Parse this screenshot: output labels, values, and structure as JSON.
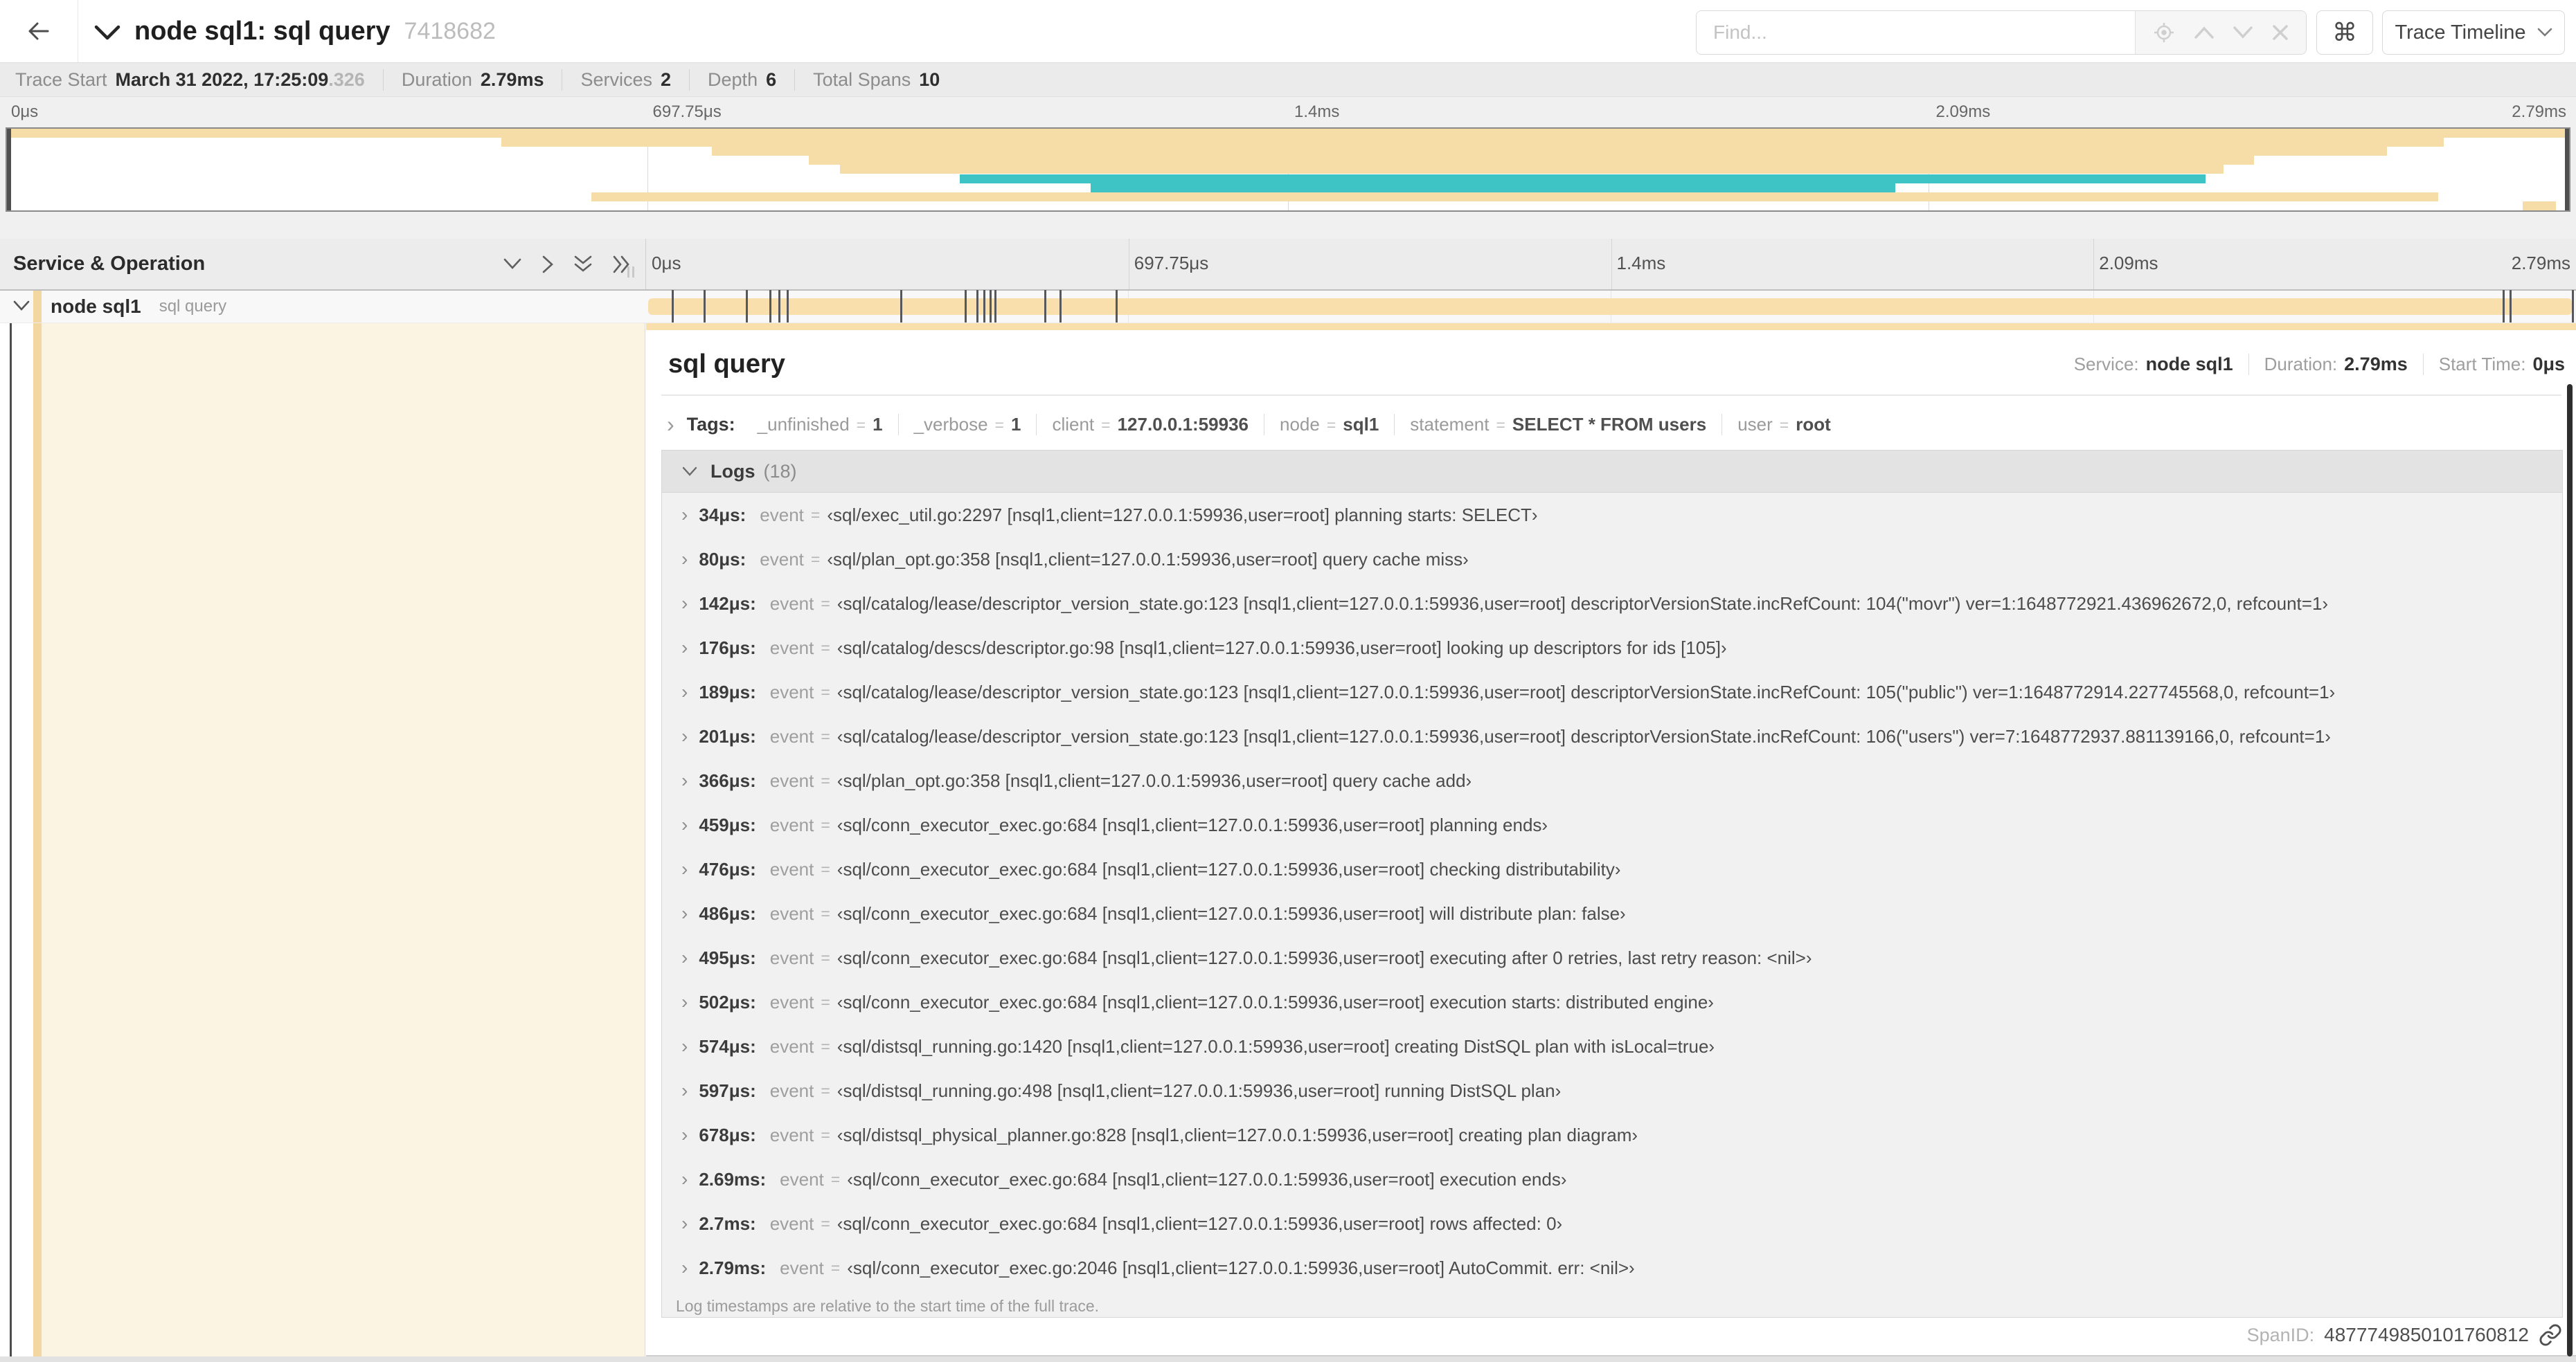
{
  "header": {
    "title": "node sql1: sql query",
    "trace_id": "7418682",
    "find_placeholder": "Find...",
    "shortcut_key": "⌘",
    "view_button": "Trace Timeline"
  },
  "trace_meta": [
    {
      "label": "Trace Start",
      "value": "March 31 2022, 17:25:09",
      "suffix": ".326"
    },
    {
      "label": "Duration",
      "value": "2.79ms"
    },
    {
      "label": "Services",
      "value": "2"
    },
    {
      "label": "Depth",
      "value": "6"
    },
    {
      "label": "Total Spans",
      "value": "10"
    }
  ],
  "timeline": {
    "ticks": [
      "0μs",
      "697.75μs",
      "1.4ms",
      "2.09ms",
      "2.79ms"
    ],
    "column_header": "Service & Operation"
  },
  "colors": {
    "tan": "#F6DCA6",
    "teal": "#3FC4C6",
    "cream": "#FCF4E3"
  },
  "minimap": {
    "rows": [
      {
        "color": "tan",
        "row": 0,
        "l": 0,
        "r": 100
      },
      {
        "color": "tan",
        "row": 1,
        "l": 19.3,
        "r": 95.1
      },
      {
        "color": "tan",
        "row": 2,
        "l": 27.5,
        "r": 92.9
      },
      {
        "color": "tan",
        "row": 3,
        "l": 31.3,
        "r": 87.7
      },
      {
        "color": "tan",
        "row": 4,
        "l": 32.5,
        "r": 86.5
      },
      {
        "color": "teal",
        "row": 5,
        "l": 37.2,
        "r": 85.8
      },
      {
        "color": "teal",
        "row": 6,
        "l": 42.3,
        "r": 73.7
      },
      {
        "color": "tan",
        "row": 7,
        "l": 22.8,
        "r": 94.9
      },
      {
        "color": "tan",
        "row": 8,
        "l": 98.2,
        "r": 99.5
      }
    ]
  },
  "span_row": {
    "service": "node sql1",
    "operation": "sql query",
    "duration_us": 2790,
    "log_marker_times_us": [
      34,
      80,
      142,
      176,
      189,
      201,
      366,
      459,
      476,
      486,
      495,
      502,
      574,
      597,
      678,
      2690,
      2700,
      2790
    ]
  },
  "detail": {
    "title": "sql query",
    "summary": [
      {
        "label": "Service:",
        "value": "node sql1"
      },
      {
        "label": "Duration:",
        "value": "2.79ms"
      },
      {
        "label": "Start Time:",
        "value": "0μs"
      }
    ],
    "tags_label": "Tags:",
    "eq": "=",
    "event_key": "event",
    "chevron_right": "›",
    "tags": [
      {
        "key": "_unfinished",
        "value": "1"
      },
      {
        "key": "_verbose",
        "value": "1"
      },
      {
        "key": "client",
        "value": "127.0.0.1:59936"
      },
      {
        "key": "node",
        "value": "sql1"
      },
      {
        "key": "statement",
        "value": "SELECT * FROM users"
      },
      {
        "key": "user",
        "value": "root"
      }
    ],
    "logs_label": "Logs",
    "logs_count": "(18)",
    "logs": [
      {
        "t": "34μs:",
        "msg": "‹sql/exec_util.go:2297 [nsql1,client=127.0.0.1:59936,user=root] planning starts: SELECT›"
      },
      {
        "t": "80μs:",
        "msg": "‹sql/plan_opt.go:358 [nsql1,client=127.0.0.1:59936,user=root] query cache miss›"
      },
      {
        "t": "142μs:",
        "msg": "‹sql/catalog/lease/descriptor_version_state.go:123 [nsql1,client=127.0.0.1:59936,user=root] descriptorVersionState.incRefCount: 104(\"movr\") ver=1:1648772921.436962672,0, refcount=1›"
      },
      {
        "t": "176μs:",
        "msg": "‹sql/catalog/descs/descriptor.go:98 [nsql1,client=127.0.0.1:59936,user=root] looking up descriptors for ids [105]›"
      },
      {
        "t": "189μs:",
        "msg": "‹sql/catalog/lease/descriptor_version_state.go:123 [nsql1,client=127.0.0.1:59936,user=root] descriptorVersionState.incRefCount: 105(\"public\") ver=1:1648772914.227745568,0, refcount=1›"
      },
      {
        "t": "201μs:",
        "msg": "‹sql/catalog/lease/descriptor_version_state.go:123 [nsql1,client=127.0.0.1:59936,user=root] descriptorVersionState.incRefCount: 106(\"users\") ver=7:1648772937.881139166,0, refcount=1›"
      },
      {
        "t": "366μs:",
        "msg": "‹sql/plan_opt.go:358 [nsql1,client=127.0.0.1:59936,user=root] query cache add›"
      },
      {
        "t": "459μs:",
        "msg": "‹sql/conn_executor_exec.go:684 [nsql1,client=127.0.0.1:59936,user=root] planning ends›"
      },
      {
        "t": "476μs:",
        "msg": "‹sql/conn_executor_exec.go:684 [nsql1,client=127.0.0.1:59936,user=root] checking distributability›"
      },
      {
        "t": "486μs:",
        "msg": "‹sql/conn_executor_exec.go:684 [nsql1,client=127.0.0.1:59936,user=root] will distribute plan: false›"
      },
      {
        "t": "495μs:",
        "msg": "‹sql/conn_executor_exec.go:684 [nsql1,client=127.0.0.1:59936,user=root] executing after 0 retries, last retry reason: <nil>›"
      },
      {
        "t": "502μs:",
        "msg": "‹sql/conn_executor_exec.go:684 [nsql1,client=127.0.0.1:59936,user=root] execution starts: distributed engine›"
      },
      {
        "t": "574μs:",
        "msg": "‹sql/distsql_running.go:1420 [nsql1,client=127.0.0.1:59936,user=root] creating DistSQL plan with isLocal=true›"
      },
      {
        "t": "597μs:",
        "msg": "‹sql/distsql_running.go:498 [nsql1,client=127.0.0.1:59936,user=root] running DistSQL plan›"
      },
      {
        "t": "678μs:",
        "msg": "‹sql/distsql_physical_planner.go:828 [nsql1,client=127.0.0.1:59936,user=root] creating plan diagram›"
      },
      {
        "t": "2.69ms:",
        "msg": "‹sql/conn_executor_exec.go:684 [nsql1,client=127.0.0.1:59936,user=root] execution ends›"
      },
      {
        "t": "2.7ms:",
        "msg": "‹sql/conn_executor_exec.go:684 [nsql1,client=127.0.0.1:59936,user=root] rows affected: 0›"
      },
      {
        "t": "2.79ms:",
        "msg": "‹sql/conn_executor_exec.go:2046 [nsql1,client=127.0.0.1:59936,user=root] AutoCommit. err: <nil>›"
      }
    ],
    "caption": "Log timestamps are relative to the start time of the full trace.",
    "span_id_label": "SpanID:",
    "span_id": "4877749850101760812"
  }
}
